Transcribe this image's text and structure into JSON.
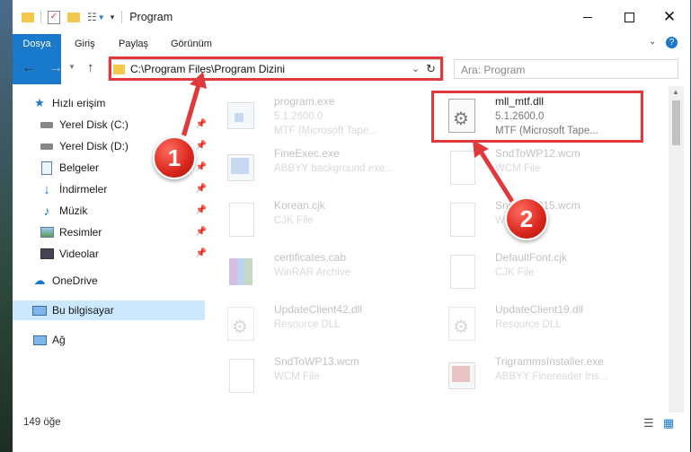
{
  "window": {
    "title": "Program"
  },
  "ribbon": {
    "tabs": [
      "Dosya",
      "Giriş",
      "Paylaş",
      "Görünüm"
    ]
  },
  "address": {
    "path": "C:\\Program Files\\Program Dizini"
  },
  "search": {
    "placeholder": "Ara: Program"
  },
  "sidebar": {
    "items": [
      {
        "label": "Hızlı erişim",
        "icon": "star-icon"
      },
      {
        "label": "Yerel Disk (C:)",
        "icon": "drive-icon"
      },
      {
        "label": "Yerel Disk (D:)",
        "icon": "drive-icon"
      },
      {
        "label": "Belgeler",
        "icon": "documents-icon"
      },
      {
        "label": "İndirmeler",
        "icon": "download-icon"
      },
      {
        "label": "Müzik",
        "icon": "music-icon"
      },
      {
        "label": "Resimler",
        "icon": "pictures-icon"
      },
      {
        "label": "Videolar",
        "icon": "videos-icon"
      },
      {
        "label": "OneDrive",
        "icon": "cloud-icon"
      },
      {
        "label": "Bu bilgisayar",
        "icon": "computer-icon"
      },
      {
        "label": "Ağ",
        "icon": "network-icon"
      }
    ]
  },
  "files": [
    {
      "name": "program.exe",
      "line2": "5.1.2600.0",
      "line3": "MTF (Microsoft Tape...",
      "icon": "exe-icon"
    },
    {
      "name": "mll_mtf.dll",
      "line2": "5.1.2600.0",
      "line3": "MTF (Microsoft Tape...",
      "icon": "dll-gear-icon"
    },
    {
      "name": "FineExec.exe",
      "line2": "ABBYY background exe...",
      "line3": "",
      "icon": "exe-icon"
    },
    {
      "name": "SndToWP12.wcm",
      "line2": "WCM File",
      "line3": "",
      "icon": "file-icon"
    },
    {
      "name": "Korean.cjk",
      "line2": "CJK File",
      "line3": "",
      "icon": "file-icon"
    },
    {
      "name": "SndToWP15.wcm",
      "line2": "WCM File",
      "line3": "",
      "icon": "file-icon"
    },
    {
      "name": "certificates.cab",
      "line2": "WinRAR Archive",
      "line3": "",
      "icon": "archive-icon"
    },
    {
      "name": "DefaultFont.cjk",
      "line2": "CJK File",
      "line3": "",
      "icon": "file-icon"
    },
    {
      "name": "UpdateClient42.dll",
      "line2": "Resource DLL",
      "line3": "",
      "icon": "dll-gear-icon"
    },
    {
      "name": "UpdateClient19.dll",
      "line2": "Resource DLL",
      "line3": "",
      "icon": "dll-gear-icon"
    },
    {
      "name": "SndToWP13.wcm",
      "line2": "WCM File",
      "line3": "",
      "icon": "file-icon"
    },
    {
      "name": "TrigrammsInstaller.exe",
      "line2": "ABBYY Finereader Ins...",
      "line3": "",
      "icon": "exe-icon"
    }
  ],
  "status": {
    "count": "149 öğe"
  },
  "annotations": {
    "badge1": "1",
    "badge2": "2"
  },
  "colors": {
    "accent": "#1979ca",
    "highlight": "#e0393b",
    "selected": "#cce8ff"
  }
}
